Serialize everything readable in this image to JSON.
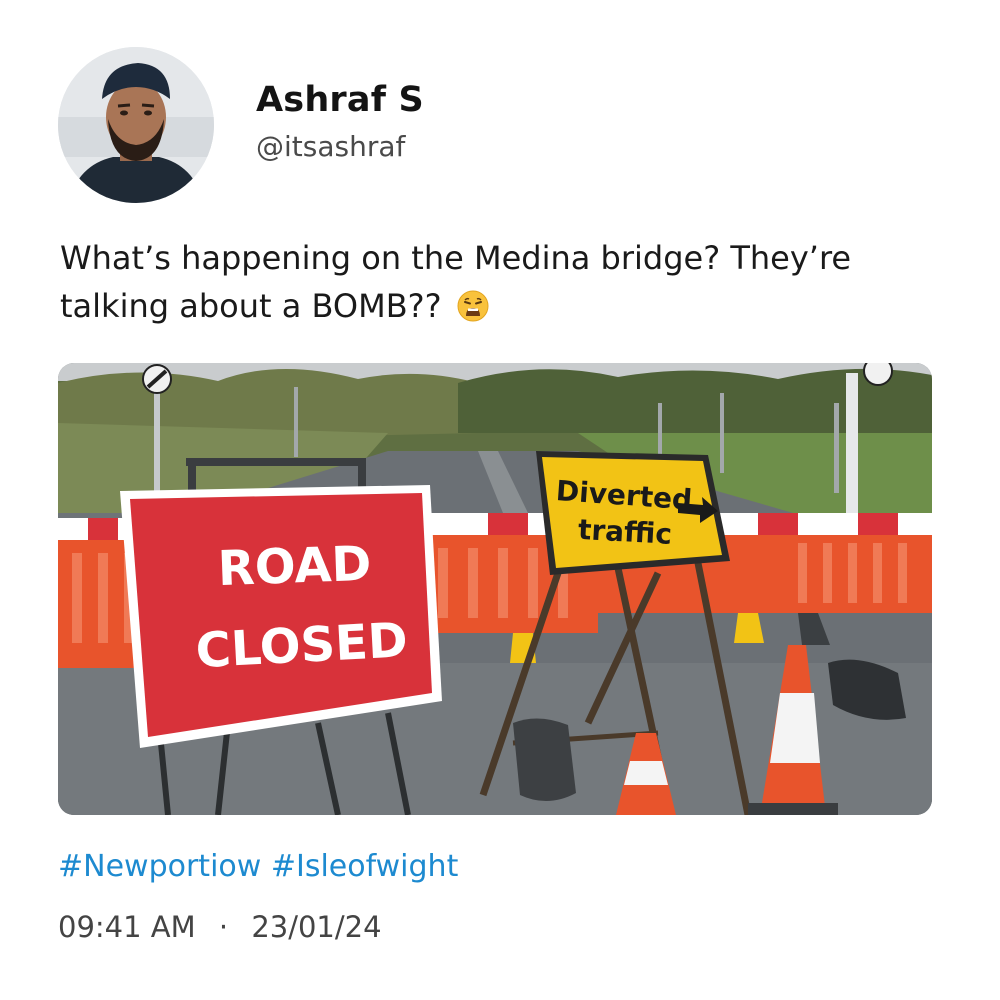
{
  "author": {
    "name": "Ashraf S",
    "handle": "@itsashraf"
  },
  "post": {
    "text": "What’s happening on the Medina bridge? They’re talking about a BOMB??",
    "emoji": "weary-face-emoji"
  },
  "media": {
    "sign_road_closed_line1": "ROAD",
    "sign_road_closed_line2": "CLOSED",
    "sign_diverted_line1": "Diverted",
    "sign_diverted_line2": "traffic"
  },
  "hashtags": [
    "#Newportiow",
    "#Isleofwight"
  ],
  "timestamp": {
    "time": "09:41 AM",
    "separator": "·",
    "date": "23/01/24"
  },
  "colors": {
    "hashtag": "#1d8ad0",
    "road_closed_sign": "#d8323a",
    "diverted_sign": "#f2c315",
    "barrier": "#e8542c"
  }
}
